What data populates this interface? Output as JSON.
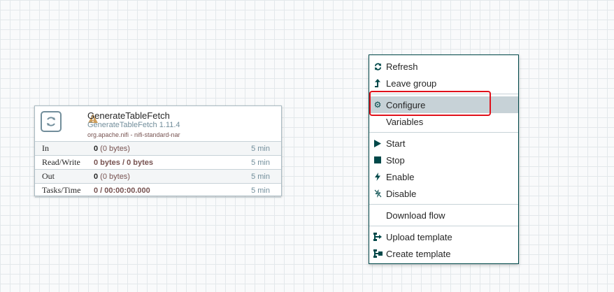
{
  "processor": {
    "name": "GenerateTableFetch",
    "type": "GenerateTableFetch 1.11.4",
    "bundle": "org.apache.nifi - nifi-standard-nar",
    "stats": [
      {
        "label": "In",
        "value_bold": "0",
        "value_rest": " (0 bytes)",
        "time": "5 min"
      },
      {
        "label": "Read/Write",
        "value_bold": "0 bytes / 0 bytes",
        "value_rest": "",
        "time": "5 min"
      },
      {
        "label": "Out",
        "value_bold": "0",
        "value_rest": " (0 bytes)",
        "time": "5 min"
      },
      {
        "label": "Tasks/Time",
        "value_bold": "0 / 00:00:00.000",
        "value_rest": "",
        "time": "5 min"
      }
    ]
  },
  "menu": {
    "items": [
      {
        "label": "Refresh",
        "icon": "refresh-icon"
      },
      {
        "label": "Leave group",
        "icon": "leave-group-icon"
      },
      {
        "label": "Configure",
        "icon": "gear-icon"
      },
      {
        "label": "Variables",
        "icon": ""
      },
      {
        "label": "Start",
        "icon": "play-icon"
      },
      {
        "label": "Stop",
        "icon": "stop-icon"
      },
      {
        "label": "Enable",
        "icon": "bolt-icon"
      },
      {
        "label": "Disable",
        "icon": "bolt-off-icon"
      },
      {
        "label": "Download flow",
        "icon": ""
      },
      {
        "label": "Upload template",
        "icon": "upload-template-icon"
      },
      {
        "label": "Create template",
        "icon": "create-template-icon"
      }
    ]
  },
  "colors": {
    "highlight": "#c7d2d7",
    "annotation": "#e0111b",
    "warning": "#cf9f5d"
  }
}
